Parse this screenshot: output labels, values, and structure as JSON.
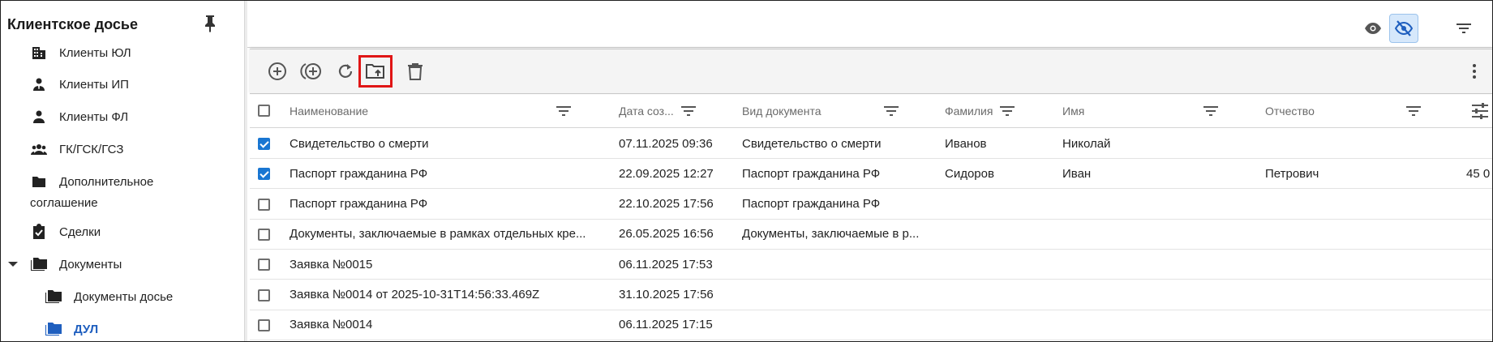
{
  "sidebar": {
    "title": "Клиентское досье",
    "items": [
      {
        "label": "Клиенты ЮЛ",
        "icon": "building-icon"
      },
      {
        "label": "Клиенты ИП",
        "icon": "person-tie-icon"
      },
      {
        "label": "Клиенты ФЛ",
        "icon": "person-icon"
      },
      {
        "label": "ГК/ГСК/ГСЗ",
        "icon": "group-icon"
      },
      {
        "label_line1": "Дополнительное",
        "label_line2": "соглашение",
        "icon": "folder-icon"
      },
      {
        "label": "Сделки",
        "icon": "clipboard-check-icon"
      },
      {
        "label": "Документы",
        "icon": "folders-icon",
        "expanded": true
      },
      {
        "label": "Документы досье",
        "icon": "folders-icon"
      },
      {
        "label": "ДУЛ",
        "icon": "folders-icon",
        "active": true
      }
    ],
    "active_color": "#1f5fbf"
  },
  "topbar": {
    "buttons": [
      "eye-icon",
      "eye-off-icon",
      "filter-icon"
    ]
  },
  "toolbar": {
    "buttons": [
      "add-circle-icon",
      "add-multiple-icon",
      "refresh-icon",
      "folder-upload-icon",
      "trash-icon",
      "more-vert-icon"
    ],
    "highlight_color": "#e01515"
  },
  "table": {
    "columns": [
      "Наименование",
      "Дата соз...",
      "Вид документа",
      "Фамилия",
      "Имя",
      "Отчество"
    ],
    "rows": [
      {
        "checked": true,
        "name": "Свидетельство о смерти",
        "date": "07.11.2025 09:36",
        "doc_type": "Свидетельство о смерти",
        "surname": "Иванов",
        "first_name": "Николай",
        "patronymic": "",
        "extra": ""
      },
      {
        "checked": true,
        "name": "Паспорт гражданина РФ",
        "date": "22.09.2025 12:27",
        "doc_type": "Паспорт гражданина РФ",
        "surname": "Сидоров",
        "first_name": "Иван",
        "patronymic": "Петрович",
        "extra": "45 0"
      },
      {
        "checked": false,
        "name": "Паспорт гражданина РФ",
        "date": "22.10.2025 17:56",
        "doc_type": "Паспорт гражданина РФ",
        "surname": "",
        "first_name": "",
        "patronymic": "",
        "extra": ""
      },
      {
        "checked": false,
        "name": "Документы, заключаемые в рамках отдельных кре...",
        "date": "26.05.2025 16:56",
        "doc_type": "Документы, заключаемые в р...",
        "surname": "",
        "first_name": "",
        "patronymic": "",
        "extra": ""
      },
      {
        "checked": false,
        "name": "Заявка №0015",
        "date": "06.11.2025 17:53",
        "doc_type": "",
        "surname": "",
        "first_name": "",
        "patronymic": "",
        "extra": ""
      },
      {
        "checked": false,
        "name": "Заявка №0014 от 2025-10-31T14:56:33.469Z",
        "date": "31.10.2025 17:56",
        "doc_type": "",
        "surname": "",
        "first_name": "",
        "patronymic": "",
        "extra": ""
      },
      {
        "checked": false,
        "name": "Заявка №0014",
        "date": "06.11.2025 17:15",
        "doc_type": "",
        "surname": "",
        "first_name": "",
        "patronymic": "",
        "extra": ""
      }
    ],
    "checkbox_color": "#1976d2"
  }
}
